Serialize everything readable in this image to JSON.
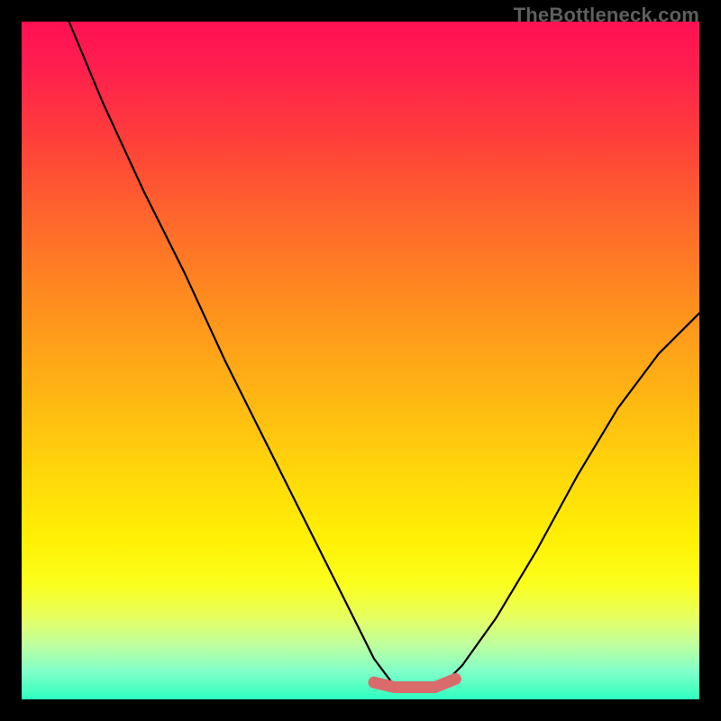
{
  "watermark": "TheBottleneck.com",
  "chart_data": {
    "type": "line",
    "title": "",
    "xlabel": "",
    "ylabel": "",
    "xlim": [
      0,
      100
    ],
    "ylim": [
      0,
      100
    ],
    "series": [
      {
        "name": "bottleneck-curve",
        "x": [
          7,
          12,
          18,
          24,
          30,
          36,
          42,
          48,
          52,
          55,
          58,
          62,
          65,
          70,
          76,
          82,
          88,
          94,
          100
        ],
        "y": [
          100,
          88,
          75,
          63,
          50,
          38,
          26,
          14,
          6,
          2,
          2,
          2,
          5,
          12,
          22,
          33,
          43,
          51,
          57
        ]
      }
    ],
    "highlight_segment": {
      "name": "flat-minimum",
      "x": [
        52,
        55,
        58,
        61,
        64
      ],
      "y": [
        2.5,
        1.8,
        1.8,
        1.8,
        3.0
      ]
    },
    "gradient_stops": [
      {
        "pos": 0,
        "color": "#ff1154"
      },
      {
        "pos": 18,
        "color": "#ff4139"
      },
      {
        "pos": 42,
        "color": "#ff8f1e"
      },
      {
        "pos": 67,
        "color": "#ffd80a"
      },
      {
        "pos": 88,
        "color": "#e6ff62"
      },
      {
        "pos": 100,
        "color": "#2effbf"
      }
    ]
  }
}
